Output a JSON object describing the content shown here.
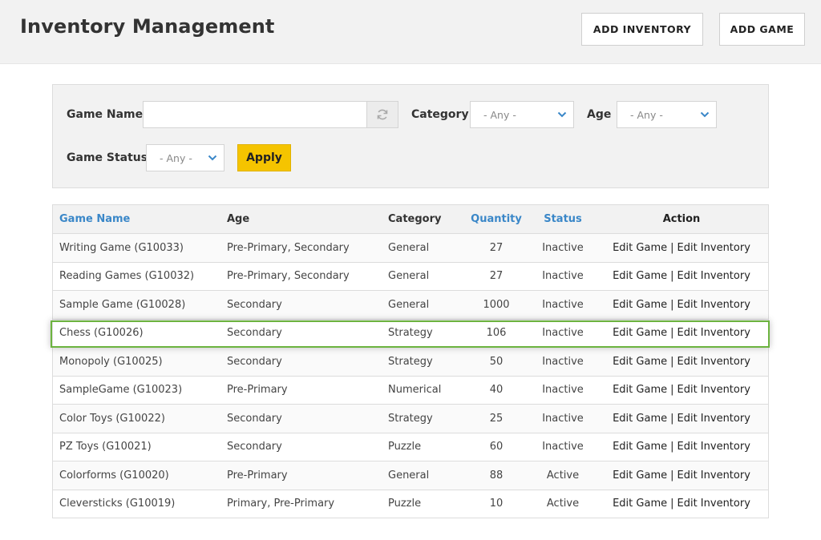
{
  "header": {
    "title": "Inventory Management",
    "add_inventory_label": "ADD INVENTORY",
    "add_game_label": "ADD GAME"
  },
  "filters": {
    "game_name_label": "Game Name",
    "game_name_value": "",
    "category_label": "Category",
    "category_value": "- Any -",
    "age_label": "Age",
    "age_value": "- Any -",
    "game_status_label": "Game Status",
    "game_status_value": "- Any -",
    "apply_label": "Apply",
    "icons": {
      "refresh": "refresh-icon",
      "dropdown": "chevron-down-icon"
    }
  },
  "table": {
    "headers": {
      "game_name": "Game Name",
      "age": "Age",
      "category": "Category",
      "quantity": "Quantity",
      "status": "Status",
      "action": "Action"
    },
    "rows": [
      {
        "name": "Writing Game (G10033)",
        "age": "Pre-Primary, Secondary",
        "category": "General",
        "quantity": "27",
        "status": "Inactive",
        "edit_game": "Edit Game",
        "sep": "|",
        "edit_inventory": "Edit Inventory"
      },
      {
        "name": "Reading Games (G10032)",
        "age": "Pre-Primary, Secondary",
        "category": "General",
        "quantity": "27",
        "status": "Inactive",
        "edit_game": "Edit Game",
        "sep": "|",
        "edit_inventory": "Edit Inventory"
      },
      {
        "name": "Sample Game (G10028)",
        "age": "Secondary",
        "category": "General",
        "quantity": "1000",
        "status": "Inactive",
        "edit_game": "Edit Game",
        "sep": "|",
        "edit_inventory": "Edit Inventory"
      },
      {
        "name": "Chess (G10026)",
        "age": "Secondary",
        "category": "Strategy",
        "quantity": "106",
        "status": "Inactive",
        "edit_game": "Edit Game",
        "sep": "|",
        "edit_inventory": "Edit Inventory"
      },
      {
        "name": "Monopoly (G10025)",
        "age": "Secondary",
        "category": "Strategy",
        "quantity": "50",
        "status": "Inactive",
        "edit_game": "Edit Game",
        "sep": "|",
        "edit_inventory": "Edit Inventory"
      },
      {
        "name": "SampleGame (G10023)",
        "age": "Pre-Primary",
        "category": "Numerical",
        "quantity": "40",
        "status": "Inactive",
        "edit_game": "Edit Game",
        "sep": "|",
        "edit_inventory": "Edit Inventory"
      },
      {
        "name": "Color Toys (G10022)",
        "age": "Secondary",
        "category": "Strategy",
        "quantity": "25",
        "status": "Inactive",
        "edit_game": "Edit Game",
        "sep": "|",
        "edit_inventory": "Edit Inventory"
      },
      {
        "name": "PZ Toys (G10021)",
        "age": "Secondary",
        "category": "Puzzle",
        "quantity": "60",
        "status": "Inactive",
        "edit_game": "Edit Game",
        "sep": "|",
        "edit_inventory": "Edit Inventory"
      },
      {
        "name": "Colorforms (G10020)",
        "age": "Pre-Primary",
        "category": "General",
        "quantity": "88",
        "status": "Active",
        "edit_game": "Edit Game",
        "sep": "|",
        "edit_inventory": "Edit Inventory"
      },
      {
        "name": "Cleversticks (G10019)",
        "age": "Primary, Pre-Primary",
        "category": "Puzzle",
        "quantity": "10",
        "status": "Active",
        "edit_game": "Edit Game",
        "sep": "|",
        "edit_inventory": "Edit Inventory"
      }
    ]
  },
  "colors": {
    "accent_link": "#3a87c8",
    "apply_button": "#f5c400",
    "highlight_border": "#6cb33f"
  }
}
